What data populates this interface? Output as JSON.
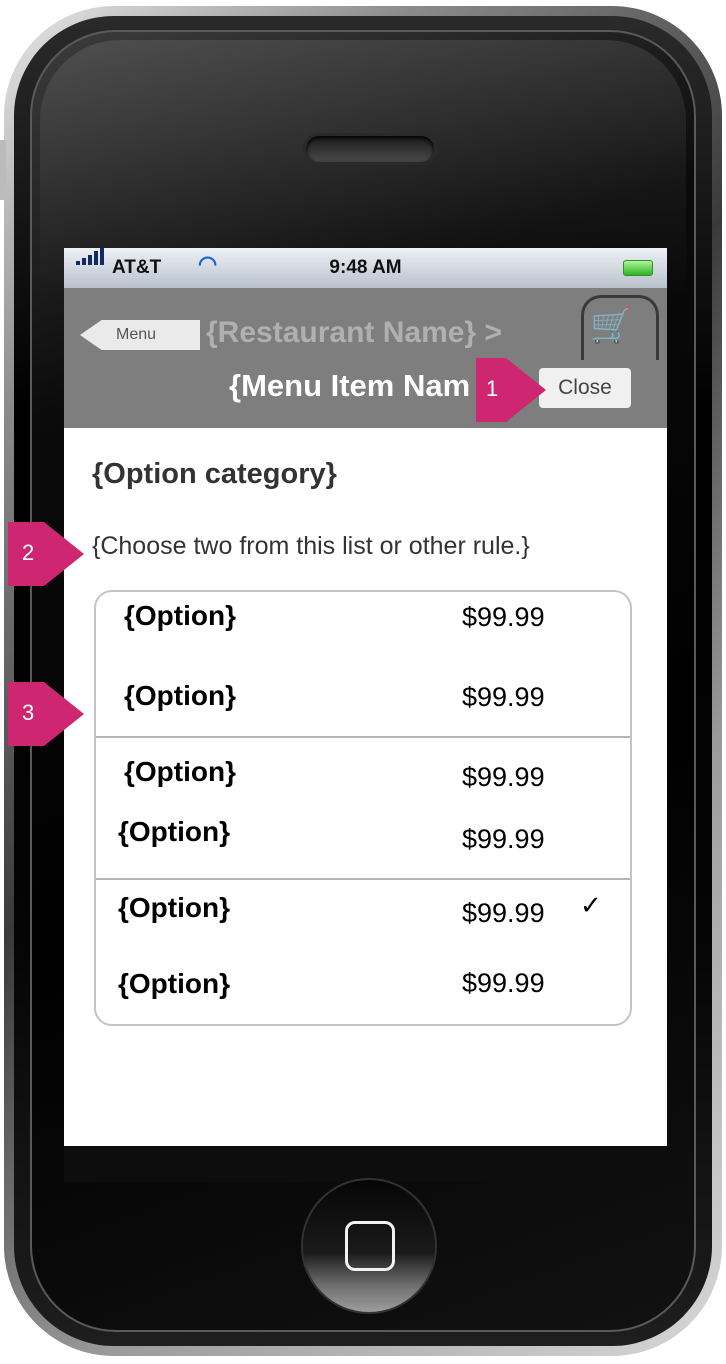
{
  "status_bar": {
    "carrier": "AT&T",
    "time": "9:48 AM",
    "signal_icon": "signal-bars-icon",
    "wifi_icon": "wifi-icon",
    "battery_icon": "battery-icon"
  },
  "nav": {
    "back_label": "Menu",
    "restaurant_name": "{Restaurant Name} >",
    "menu_item_name": "{Menu Item Nam",
    "close_label": "Close",
    "cart_icon": "shopping-cart-icon"
  },
  "content": {
    "category_title": "{Option category}",
    "rule_text": "{Choose two from this list or other rule.}",
    "groups": [
      {
        "options": [
          {
            "label": "{Option}",
            "price": "$99.99",
            "checked": false
          },
          {
            "label": "{Option}",
            "price": "$99.99",
            "checked": false
          }
        ]
      },
      {
        "options": [
          {
            "label": "{Option}",
            "price": "$99.99",
            "checked": false
          },
          {
            "label": "{Option}",
            "price": "$99.99",
            "checked": false
          }
        ]
      },
      {
        "options": [
          {
            "label": "{Option}",
            "price": "$99.99",
            "checked": true
          },
          {
            "label": "{Option}",
            "price": "$99.99",
            "checked": false
          }
        ]
      }
    ],
    "check_mark": "✓"
  },
  "annotations": {
    "marker_1": "1",
    "marker_2": "2",
    "marker_3": "3",
    "color": "#cf2672"
  }
}
